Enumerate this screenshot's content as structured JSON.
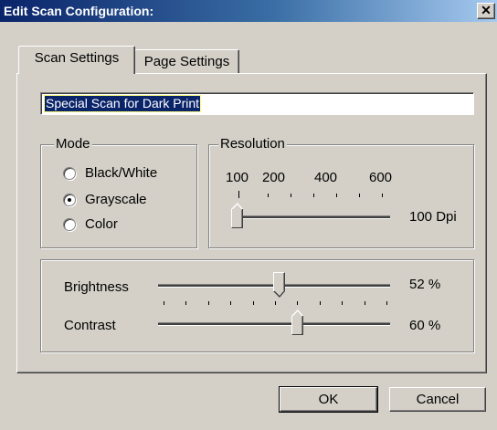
{
  "window": {
    "title": "Edit Scan Configuration:",
    "close_glyph": "✕"
  },
  "tabs": [
    {
      "label": "Scan Settings",
      "active": true
    },
    {
      "label": "Page Settings",
      "active": false
    }
  ],
  "config_name": "Special Scan for Dark Print",
  "mode": {
    "label": "Mode",
    "options": [
      {
        "label": "Black/White",
        "checked": false
      },
      {
        "label": "Grayscale",
        "checked": true
      },
      {
        "label": "Color",
        "checked": false
      }
    ]
  },
  "resolution": {
    "label": "Resolution",
    "tick_labels": [
      "100",
      "200",
      "400",
      "600"
    ],
    "value_text": "100  Dpi",
    "value": 100
  },
  "brightness": {
    "label": "Brightness",
    "value": 52,
    "value_text": "52 %"
  },
  "contrast": {
    "label": "Contrast",
    "value": 60,
    "value_text": "60 %"
  },
  "buttons": {
    "ok": "OK",
    "cancel": "Cancel"
  }
}
